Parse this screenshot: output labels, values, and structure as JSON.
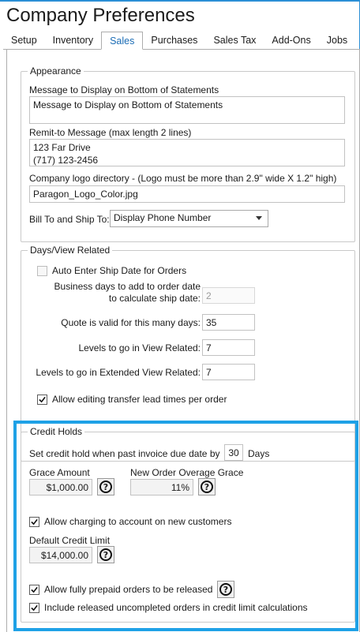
{
  "window": {
    "title": "Company Preferences"
  },
  "tabs": [
    "Setup",
    "Inventory",
    "Sales",
    "Purchases",
    "Sales Tax",
    "Add-Ons",
    "Jobs"
  ],
  "active_tab": "Sales",
  "appearance": {
    "legend": "Appearance",
    "statement_msg_label": "Message to Display on Bottom of Statements",
    "statement_msg_value": "Message to Display on Bottom of Statements",
    "remit_label": "Remit-to Message (max length 2 lines)",
    "remit_value": "123 Far Drive\n(717) 123-2456",
    "logo_label": "Company logo directory - (Logo must be more than 2.9\" wide X 1.2\" high)",
    "logo_value": "Paragon_Logo_Color.jpg",
    "billship_label": "Bill To and Ship To:",
    "billship_value": "Display Phone Number"
  },
  "days": {
    "legend": "Days/View Related",
    "auto_ship_label": "Auto Enter Ship Date for Orders",
    "auto_ship_checked": false,
    "business_days_label_1": "Business days to add to order date",
    "business_days_label_2": "to calculate ship date:",
    "business_days_value": "2",
    "quote_label": "Quote is valid for this many days:",
    "quote_value": "35",
    "levels_label": "Levels to go in View Related:",
    "levels_value": "7",
    "ext_levels_label": "Levels to go in Extended View Related:",
    "ext_levels_value": "7",
    "lead_times_label": "Allow editing transfer lead times per order",
    "lead_times_checked": true
  },
  "credit": {
    "legend": "Credit Holds",
    "past_due_label": "Set credit hold when past invoice due date by",
    "past_due_value": "30",
    "past_due_unit": "Days",
    "grace_label": "Grace Amount",
    "grace_value": "$1,000.00",
    "overage_label": "New Order Overage Grace",
    "overage_value": "11%",
    "charging_label": "Allow charging to account on new customers",
    "charging_checked": true,
    "default_limit_label": "Default Credit Limit",
    "default_limit_value": "$14,000.00",
    "prepaid_label": "Allow fully prepaid orders to be released",
    "prepaid_checked": true,
    "include_label": "Include released uncompleted orders in credit limit calculations",
    "include_checked": true
  },
  "colors": {
    "accent": "#1ea1e6",
    "tab_active": "#1b6cb5"
  }
}
